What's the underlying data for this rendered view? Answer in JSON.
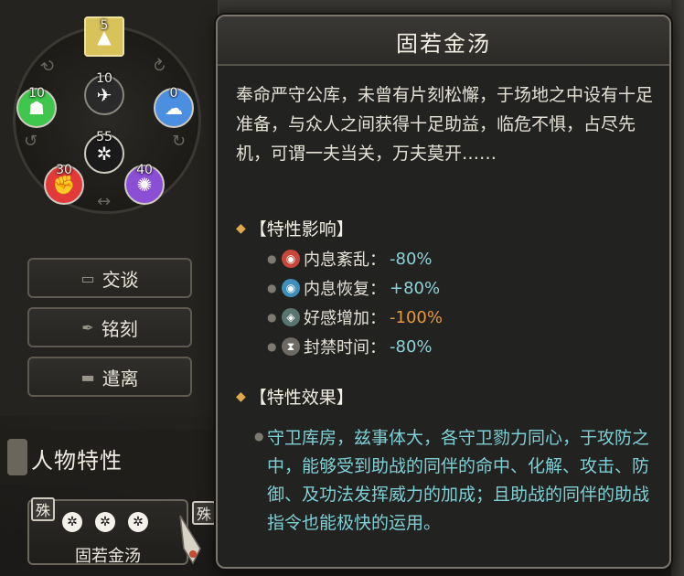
{
  "wheel": {
    "nodes": [
      {
        "id": "top",
        "value": "5",
        "color": "#d8c25a",
        "icon": "tent-icon"
      },
      {
        "id": "inner-top",
        "value": "10",
        "color": "#f2f2f2",
        "icon": "bird-icon"
      },
      {
        "id": "left",
        "value": "10",
        "color": "#3ec64d",
        "icon": "body-icon"
      },
      {
        "id": "right",
        "value": "0",
        "color": "#4b8fe0",
        "icon": "lungs-icon"
      },
      {
        "id": "center",
        "value": "55",
        "color": "#f2f2f2",
        "icon": "knot-icon"
      },
      {
        "id": "bottom-left",
        "value": "30",
        "color": "#e23a3a",
        "icon": "arm-icon"
      },
      {
        "id": "bottom-right",
        "value": "40",
        "color": "#8b4fd6",
        "icon": "flame-icon"
      }
    ]
  },
  "side_buttons": [
    {
      "label": "交谈",
      "icon": "chat-icon"
    },
    {
      "label": "铭刻",
      "icon": "engrave-icon"
    },
    {
      "label": "遣离",
      "icon": "dismiss-icon"
    }
  ],
  "trait_section": {
    "title": "人物特性",
    "card": {
      "badge": "殊",
      "name": "固若金汤",
      "pips": 3
    },
    "next_badge": "殊"
  },
  "tooltip": {
    "title": "固若金汤",
    "description": "奉命严守公库，未曾有片刻松懈，于场地之中设有十足准备，与众人之间获得十足助益，临危不惧，占尽先机，可谓一夫当关，万夫莫开……",
    "influence_header": "【特性影响】",
    "stats": [
      {
        "name": "内息紊乱：",
        "value": "-80%",
        "icon": "lungs-red-icon",
        "color": "#c9463d",
        "negative": false
      },
      {
        "name": "内息恢复：",
        "value": "+80%",
        "icon": "lungs-blue-icon",
        "color": "#3f8fb8",
        "negative": false
      },
      {
        "name": "好感增加：",
        "value": "-100%",
        "icon": "favor-icon",
        "color": "#59756f",
        "negative": true
      },
      {
        "name": "封禁时间：",
        "value": "-80%",
        "icon": "hourglass-icon",
        "color": "#6d6a63",
        "negative": false
      }
    ],
    "effect_header": "【特性效果】",
    "effect_text": "守卫库房，兹事体大，各守卫勠力同心，于攻防之中，能够受到助战的同伴的命中、化解、攻击、防御、及功法发挥威力的加成；且助战的同伴的助战指令也能极快的运用。"
  }
}
